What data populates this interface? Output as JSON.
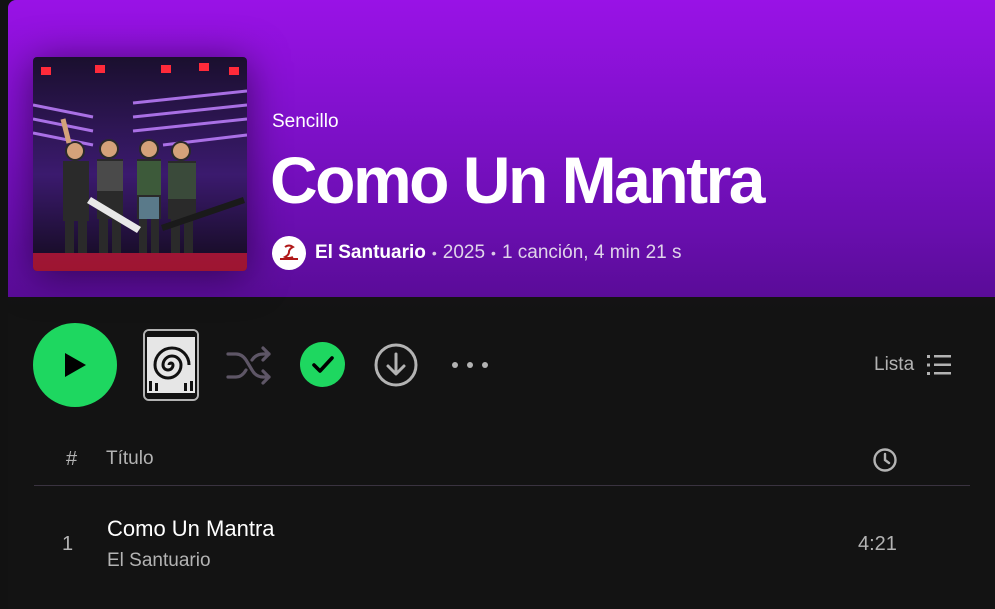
{
  "album": {
    "type_label": "Sencillo",
    "title": "Como Un Mantra",
    "artist": "El Santuario",
    "year": "2025",
    "summary": "1 canción, 4 min 21 s",
    "separator": "•",
    "cover_icon": "band-photo"
  },
  "controls": {
    "play_icon": "play-icon",
    "shuffle_icon": "shuffle-icon",
    "saved_icon": "check-icon",
    "download_icon": "download-icon",
    "more_icon": "more-options-icon",
    "view_label": "Lista",
    "view_icon": "list-icon"
  },
  "track_header": {
    "number": "#",
    "title": "Título",
    "duration_icon": "clock-icon"
  },
  "tracks": [
    {
      "number": "1",
      "title": "Como Un Mantra",
      "artist": "El Santuario",
      "duration": "4:21"
    }
  ],
  "colors": {
    "accent": "#1ed760",
    "hero": "#8311cf",
    "background": "#121212",
    "muted_text": "#b3b3b3"
  }
}
